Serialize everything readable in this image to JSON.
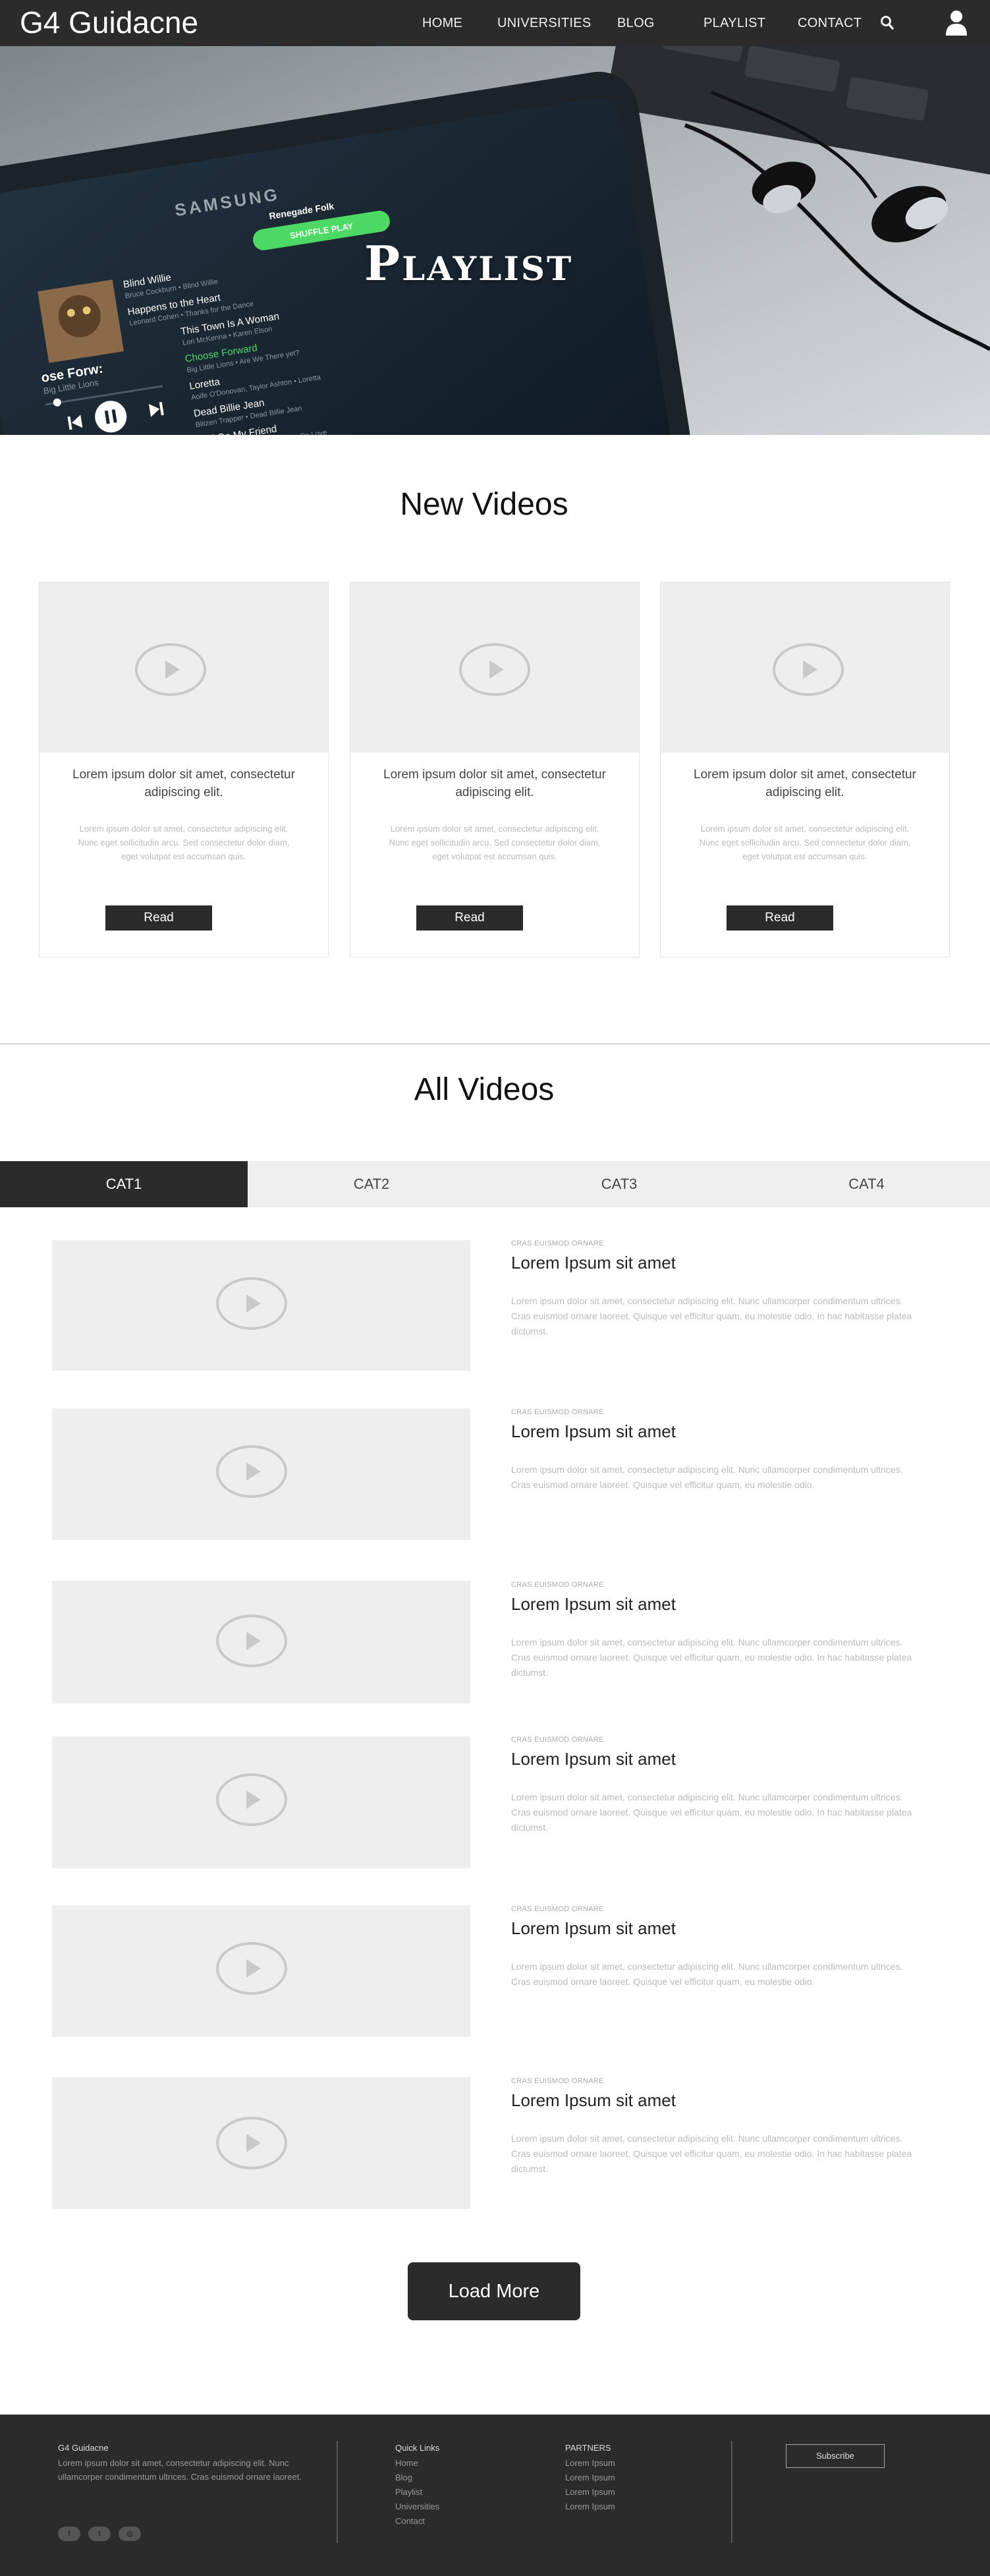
{
  "header": {
    "brand": "G4 Guidacne",
    "nav": [
      "HOME",
      "UNIVERSITIES",
      "BLOG",
      "PLAYLIST",
      "CONTACT"
    ],
    "search_icon": "search-icon",
    "user_icon": "user-icon"
  },
  "hero": {
    "title": "Playlist",
    "photo": {
      "brand": "SAMSUNG",
      "playlist_name": "Renegade Folk",
      "shuffle_label": "SHUFFLE PLAY",
      "now_playing": "ose Forw:",
      "now_playing_sub": "Big Little Lions",
      "tracks": [
        {
          "title": "Blind Willie",
          "sub": "Bruce Cockburn • Blind Willie"
        },
        {
          "title": "Happens to the Heart",
          "sub": "Leonard Cohen • Thanks for the Dance"
        },
        {
          "title": "This Town Is A Woman",
          "sub": "Lori McKenna • Karen Elson"
        },
        {
          "title": "Choose Forward",
          "sub": "Big Little Lions • Are We There yet?"
        },
        {
          "title": "Loretta",
          "sub": "Aoife O'Donovan, Taylor Ashton • Loretta"
        },
        {
          "title": "Dead Billie Jean",
          "sub": "Blitzen Trapper • Dead Billie Jean"
        },
        {
          "title": "Roll On My Friend",
          "sub": "Phoebe & Jason Romero • Get On Love"
        }
      ],
      "accent_color": "#4cd964"
    }
  },
  "new_videos": {
    "title": "New Videos",
    "cards": [
      {
        "title": "Lorem ipsum dolor sit amet, consectetur adipiscing elit.",
        "text": "Lorem ipsum dolor sit amet, consectetur adipiscing elit. Nunc eget sollicitudin arcu. Sed consectetur dolor diam, eget volutpat est accumsan quis.",
        "button": "Read"
      },
      {
        "title": "Lorem ipsum dolor sit amet, consectetur adipiscing elit.",
        "text": "Lorem ipsum dolor sit amet, consectetur adipiscing elit. Nunc eget sollicitudin arcu. Sed consectetur dolor diam, eget volutpat est accumsan quis.",
        "button": "Read"
      },
      {
        "title": "Lorem ipsum dolor sit amet, consectetur adipiscing elit.",
        "text": "Lorem ipsum dolor sit amet, consectetur adipiscing elit. Nunc eget sollicitudin arcu. Sed consectetur dolor diam, eget volutpat est accumsan quis.",
        "button": "Read"
      }
    ]
  },
  "all_videos": {
    "title": "All Videos",
    "tabs": [
      {
        "label": "CAT1",
        "active": true
      },
      {
        "label": "CAT2",
        "active": false
      },
      {
        "label": "CAT3",
        "active": false
      },
      {
        "label": "CAT4",
        "active": false
      }
    ],
    "items": [
      {
        "kicker": "CRAS EUISMOD ORNARE",
        "title": "Lorem Ipsum sit amet",
        "text": "Lorem ipsum dolor sit amet, consectetur adipiscing elit. Nunc ullamcorper condimentum ultrices. Cras euismod ornare laoreet. Quisque vel efficitur quam, eu molestie odio. In hac habitasse platea dictumst."
      },
      {
        "kicker": "CRAS EUISMOD ORNARE",
        "title": "Lorem Ipsum sit amet",
        "text": "Lorem ipsum dolor sit amet, consectetur adipiscing elit. Nunc ullamcorper condimentum ultrices. Cras euismod ornare laoreet. Quisque vel efficitur quam, eu molestie odio."
      },
      {
        "kicker": "CRAS EUISMOD ORNARE",
        "title": "Lorem Ipsum sit amet",
        "text": "Lorem ipsum dolor sit amet, consectetur adipiscing elit. Nunc ullamcorper condimentum ultrices. Cras euismod ornare laoreet. Quisque vel efficitur quam, eu molestie odio. In hac habitasse platea dictumst."
      },
      {
        "kicker": "CRAS EUISMOD ORNARE",
        "title": "Lorem Ipsum sit amet",
        "text": "Lorem ipsum dolor sit amet, consectetur adipiscing elit. Nunc ullamcorper condimentum ultrices. Cras euismod ornare laoreet. Quisque vel efficitur quam, eu molestie odio. In hac habitasse platea dictumst."
      },
      {
        "kicker": "CRAS EUISMOD ORNARE",
        "title": "Lorem Ipsum sit amet",
        "text": "Lorem ipsum dolor sit amet, consectetur adipiscing elit. Nunc ullamcorper condimentum ultrices. Cras euismod ornare laoreet. Quisque vel efficitur quam, eu molestie odio."
      },
      {
        "kicker": "CRAS EUISMOD ORNARE",
        "title": "Lorem Ipsum sit amet",
        "text": "Lorem ipsum dolor sit amet, consectetur adipiscing elit. Nunc ullamcorper condimentum ultrices. Cras euismod ornare laoreet. Quisque vel efficitur quam, eu molestie odio. In hac habitasse platea dictumst."
      }
    ],
    "load_more": "Load More"
  },
  "footer": {
    "about_title": "G4 Guidacne",
    "about_text": "Lorem ipsum dolor sit amet, consectetur adipiscing elit. Nunc ullamcorper condimentum ultrices. Cras euismod ornare laoreet.",
    "quick_links_title": "Quick Links",
    "quick_links": [
      "Home",
      "Blog",
      "Playlist",
      "Universities",
      "Contact"
    ],
    "partners_title": "PARTNERS",
    "partners": [
      "Lorem Ipsum",
      "Lorem Ipsum",
      "Lorem Ipsum",
      "Lorem Ipsum"
    ],
    "subscribe": "Subscribe",
    "social": [
      {
        "icon": "facebook-icon",
        "glyph": "f"
      },
      {
        "icon": "twitter-icon",
        "glyph": "t"
      },
      {
        "icon": "dribbble-icon",
        "glyph": "◎"
      }
    ]
  },
  "colors": {
    "dark": "#2b2b2b",
    "placeholder": "#eeeeee",
    "tab_inactive": "#efefef",
    "muted_text": "#bbbbbb"
  }
}
